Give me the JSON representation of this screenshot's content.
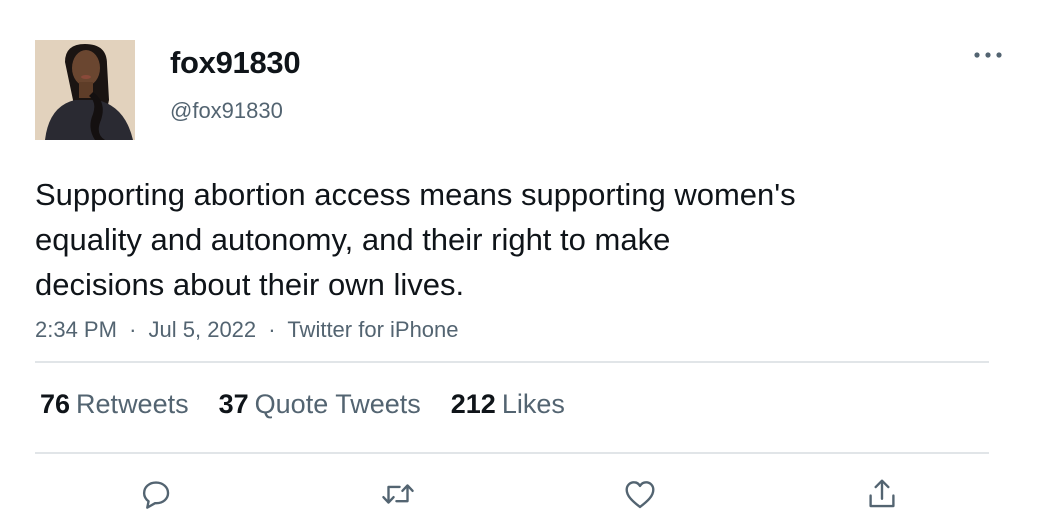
{
  "author": {
    "display_name": "fox91830",
    "handle": "@fox91830",
    "avatar_icon": "user-avatar-photo"
  },
  "tweet": {
    "lines": [
      "Supporting abortion access means supporting women's",
      "equality and autonomy, and their right to make",
      "decisions about their own lives."
    ]
  },
  "meta": {
    "time": "2:34 PM",
    "separator": "·",
    "date": "Jul 5, 2022",
    "source": "Twitter for iPhone"
  },
  "stats": {
    "retweets": {
      "count": "76",
      "label": "Retweets"
    },
    "quotes": {
      "count": "37",
      "label": "Quote Tweets"
    },
    "likes": {
      "count": "212",
      "label": "Likes"
    }
  },
  "actions": {
    "icons": [
      "reply-icon",
      "retweet-icon",
      "like-icon",
      "share-icon"
    ]
  },
  "colors": {
    "text_primary": "#0f1419",
    "text_secondary": "#536471",
    "divider": "#e1e5e8",
    "icon": "#536471"
  }
}
